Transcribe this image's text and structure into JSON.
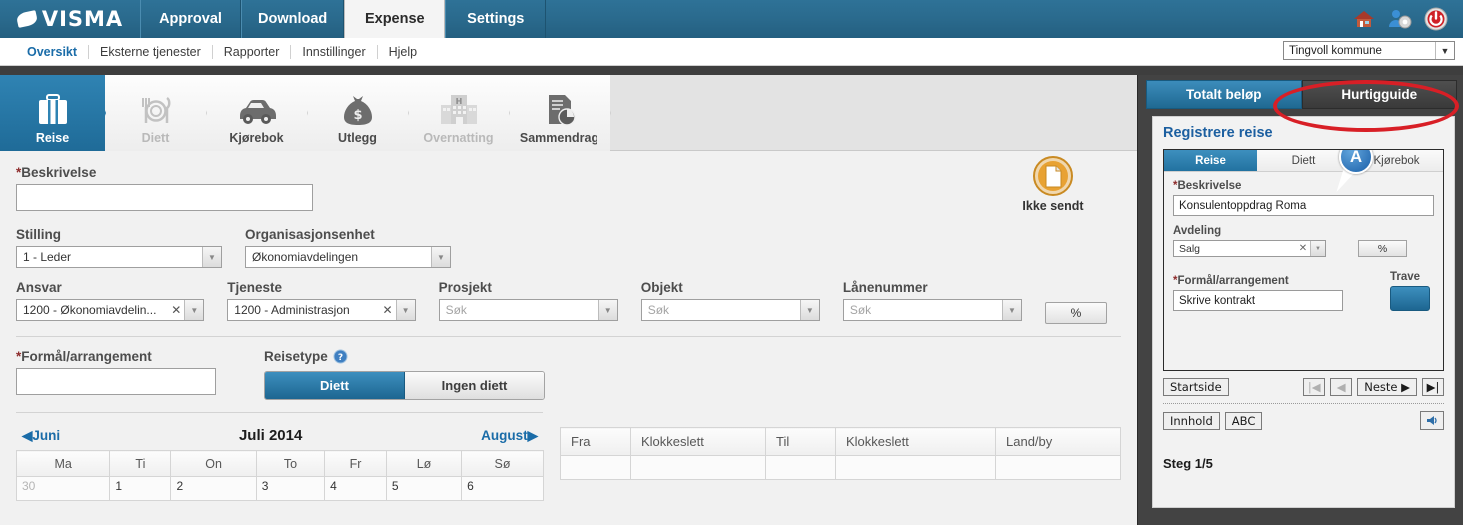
{
  "topnav": {
    "brand": "VISMA",
    "tabs": [
      {
        "label": "Approval",
        "active": false
      },
      {
        "label": "Download",
        "active": false
      },
      {
        "label": "Expense",
        "active": true
      },
      {
        "label": "Settings",
        "active": false
      }
    ],
    "icons": [
      "house-icon",
      "user-settings-icon",
      "power-icon"
    ]
  },
  "subnav": {
    "links": [
      "Oversikt",
      "Eksterne tjenester",
      "Rapporter",
      "Innstillinger",
      "Hjelp"
    ],
    "org_selected": "Tingvoll kommune"
  },
  "steptabs": [
    {
      "label": "Reise",
      "icon": "suitcase-icon",
      "state": "active"
    },
    {
      "label": "Diett",
      "icon": "plate-cutlery-icon",
      "state": "disabled"
    },
    {
      "label": "Kjørebok",
      "icon": "car-icon",
      "state": "enabled"
    },
    {
      "label": "Utlegg",
      "icon": "money-bag-icon",
      "state": "enabled"
    },
    {
      "label": "Overnatting",
      "icon": "hotel-icon",
      "state": "disabled"
    },
    {
      "label": "Sammendrag",
      "icon": "report-chart-icon",
      "state": "enabled"
    }
  ],
  "form": {
    "beskrivelse_label": "Beskrivelse",
    "beskrivelse_value": "",
    "status_label": "Ikke sendt",
    "stilling_label": "Stilling",
    "stilling_value": "1 - Leder",
    "org_label": "Organisasjonsenhet",
    "org_value": "Økonomiavdelingen",
    "ansvar_label": "Ansvar",
    "ansvar_value": "1200 - Økonomiavdelin...",
    "tjeneste_label": "Tjeneste",
    "tjeneste_value": "1200 - Administrasjon",
    "prosjekt_label": "Prosjekt",
    "prosjekt_placeholder": "Søk",
    "objekt_label": "Objekt",
    "objekt_placeholder": "Søk",
    "lanenummer_label": "Lånenummer",
    "lanenummer_placeholder": "Søk",
    "pct_label": "%",
    "formal_label": "Formål/arrangement",
    "formal_value": "",
    "reisetype_label": "Reisetype",
    "reisetype_options": [
      "Diett",
      "Ingen diett"
    ],
    "reisetype_selected": "Diett",
    "clear_symbol": "✕"
  },
  "calendar": {
    "prev_month": "Juni",
    "title": "Juli 2014",
    "next_month": "August",
    "daynames": [
      "Ma",
      "Ti",
      "On",
      "To",
      "Fr",
      "Lø",
      "Sø"
    ],
    "first_row": [
      {
        "day": "30",
        "other": true
      },
      {
        "day": "1",
        "other": false
      },
      {
        "day": "2",
        "other": false
      },
      {
        "day": "3",
        "other": false
      },
      {
        "day": "4",
        "other": false
      },
      {
        "day": "5",
        "other": false
      },
      {
        "day": "6",
        "other": false
      }
    ]
  },
  "trip_table": {
    "headers": [
      "Fra",
      "Klokkeslett",
      "Til",
      "Klokkeslett",
      "Land/by"
    ]
  },
  "right_panel": {
    "tab_total": "Totalt beløp",
    "tab_guide": "Hurtigguide",
    "guide_title": "Registrere reise",
    "guide_tabs": [
      "Reise",
      "Diett",
      "Kjørebok"
    ],
    "g_beskrivelse_label": "Beskrivelse",
    "g_beskrivelse_value": "Konsulentoppdrag Roma",
    "g_avdeling_label": "Avdeling",
    "g_avdeling_value": "Salg",
    "g_pct_label": "%",
    "g_formal_label": "Formål/arrangement",
    "g_formal_value": "Skrive kontrakt",
    "g_trave_label": "Trave",
    "callout_letter": "A",
    "nav_startside": "Startside",
    "nav_first": "|◀",
    "nav_prev": "◀",
    "nav_next": "Neste ▶",
    "nav_last": "▶|",
    "nav_innhold": "Innhold",
    "nav_abc": "ABC",
    "steg": "Steg 1/5"
  },
  "colors": {
    "brand_blue": "#2a6a8d",
    "accent_blue": "#2272a0",
    "panel_dark": "#434343",
    "highlight_red": "#d81f26",
    "link_blue": "#1a6ca8",
    "required_red": "#8d2b2b"
  }
}
